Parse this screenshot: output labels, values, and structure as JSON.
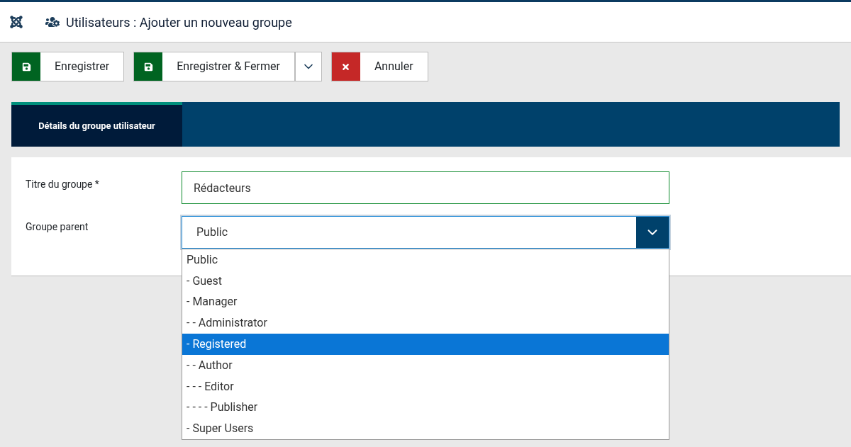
{
  "header": {
    "title": "Utilisateurs : Ajouter un nouveau groupe"
  },
  "toolbar": [
    {
      "kind": "save",
      "label": "Enregistrer",
      "split": false
    },
    {
      "kind": "save",
      "label": "Enregistrer & Fermer",
      "split": true
    },
    {
      "kind": "cancel",
      "label": "Annuler",
      "split": false
    }
  ],
  "tabs": [
    {
      "label": "Détails du groupe utilisateur",
      "selected": true
    }
  ],
  "form": {
    "title_label": "Titre du groupe *",
    "title_value": "Rédacteurs",
    "parent_label": "Groupe parent",
    "parent_value": "Public",
    "expanded": true,
    "options": [
      {
        "label": "Public",
        "selected": false
      },
      {
        "label": "- Guest",
        "selected": false
      },
      {
        "label": "- Manager",
        "selected": false
      },
      {
        "label": "- - Administrator",
        "selected": false
      },
      {
        "label": "- Registered",
        "selected": true
      },
      {
        "label": "- - Author",
        "selected": false
      },
      {
        "label": "- - - Editor",
        "selected": false
      },
      {
        "label": "- - - - Publisher",
        "selected": false
      },
      {
        "label": "- Super Users",
        "selected": false
      }
    ]
  }
}
